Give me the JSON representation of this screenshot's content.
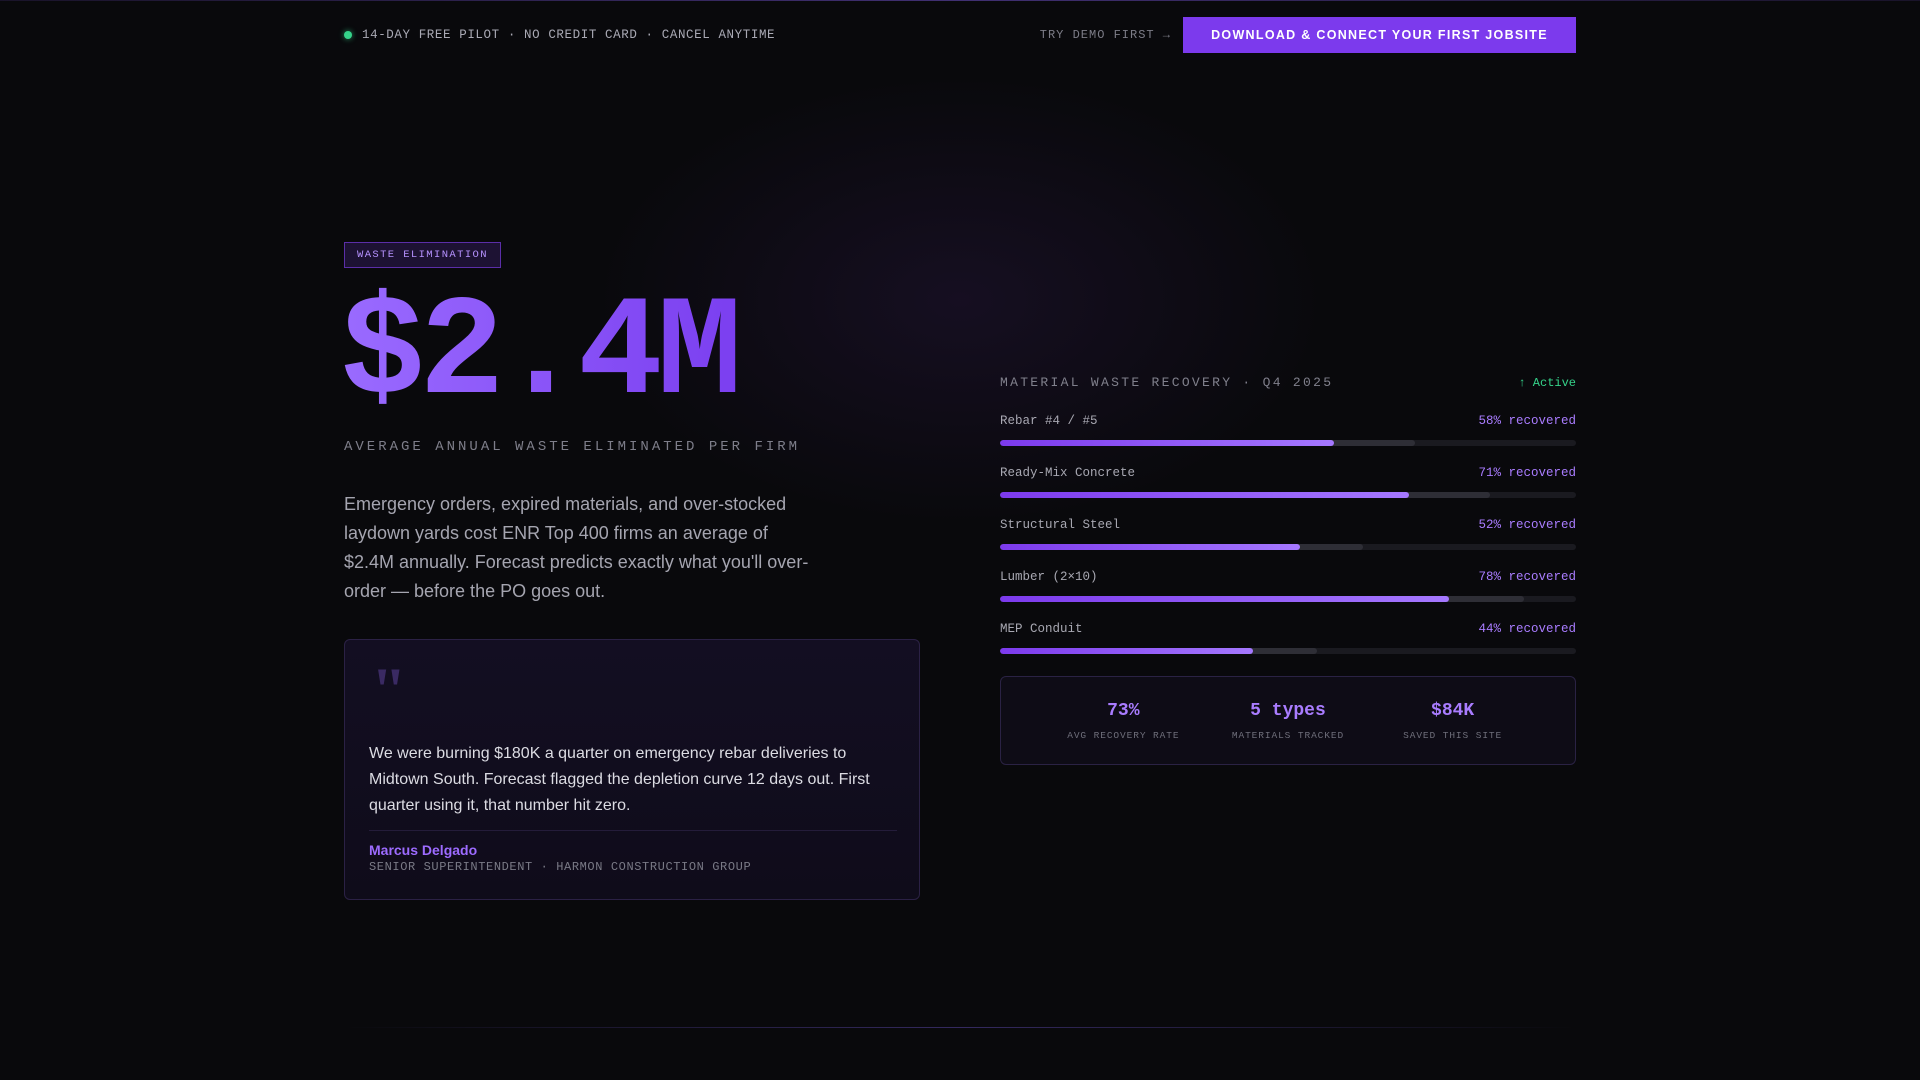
{
  "topbar": {
    "pilot_text": "14-DAY FREE PILOT · NO CREDIT CARD · CANCEL ANYTIME",
    "demo_link": "TRY DEMO FIRST →",
    "cta_label": "DOWNLOAD & CONNECT YOUR FIRST JOBSITE",
    "status_dot_color": "#35d38a"
  },
  "hero": {
    "badge": "WASTE ELIMINATION",
    "big_stat": "$2.4M",
    "stat_caption": "AVERAGE ANNUAL WASTE ELIMINATED PER FIRM",
    "lede": "Emergency orders, expired materials, and over-stocked laydown yards cost ENR Top 400 firms an average of $2.4M annually. Forecast predicts exactly what you'll over-order — before the PO goes out."
  },
  "testimonial": {
    "quote_icon": "quote-icon",
    "quote": "We were burning $180K a quarter on emergency rebar deliveries to Midtown South. Forecast flagged the depletion curve 12 days out. First quarter using it, that number hit zero.",
    "author": "Marcus Delgado",
    "role": "SENIOR SUPERINTENDENT · HARMON CONSTRUCTION GROUP"
  },
  "recovery": {
    "title": "MATERIAL WASTE RECOVERY · Q4 2025",
    "status": "↑ Active",
    "items": [
      {
        "label": "Rebar #4 / #5",
        "value_text": "58% recovered",
        "recovered": 0.58,
        "secondary_level": 0.72
      },
      {
        "label": "Ready-Mix Concrete",
        "value_text": "71% recovered",
        "recovered": 0.71,
        "secondary_level": 0.85
      },
      {
        "label": "Structural Steel",
        "value_text": "52% recovered",
        "recovered": 0.52,
        "secondary_level": 0.63
      },
      {
        "label": "Lumber (2×10)",
        "value_text": "78% recovered",
        "recovered": 0.78,
        "secondary_level": 0.91
      },
      {
        "label": "MEP Conduit",
        "value_text": "44% recovered",
        "recovered": 0.44,
        "secondary_level": 0.55
      }
    ],
    "summary": [
      {
        "value": "73%",
        "label": "AVG RECOVERY RATE"
      },
      {
        "value": "5 types",
        "label": "MATERIALS TRACKED"
      },
      {
        "value": "$84K",
        "label": "SAVED THIS SITE"
      }
    ]
  },
  "colors": {
    "accent": "#7c3aed",
    "accent_light": "#a97cff",
    "success": "#35d38a",
    "background": "#09090c"
  }
}
